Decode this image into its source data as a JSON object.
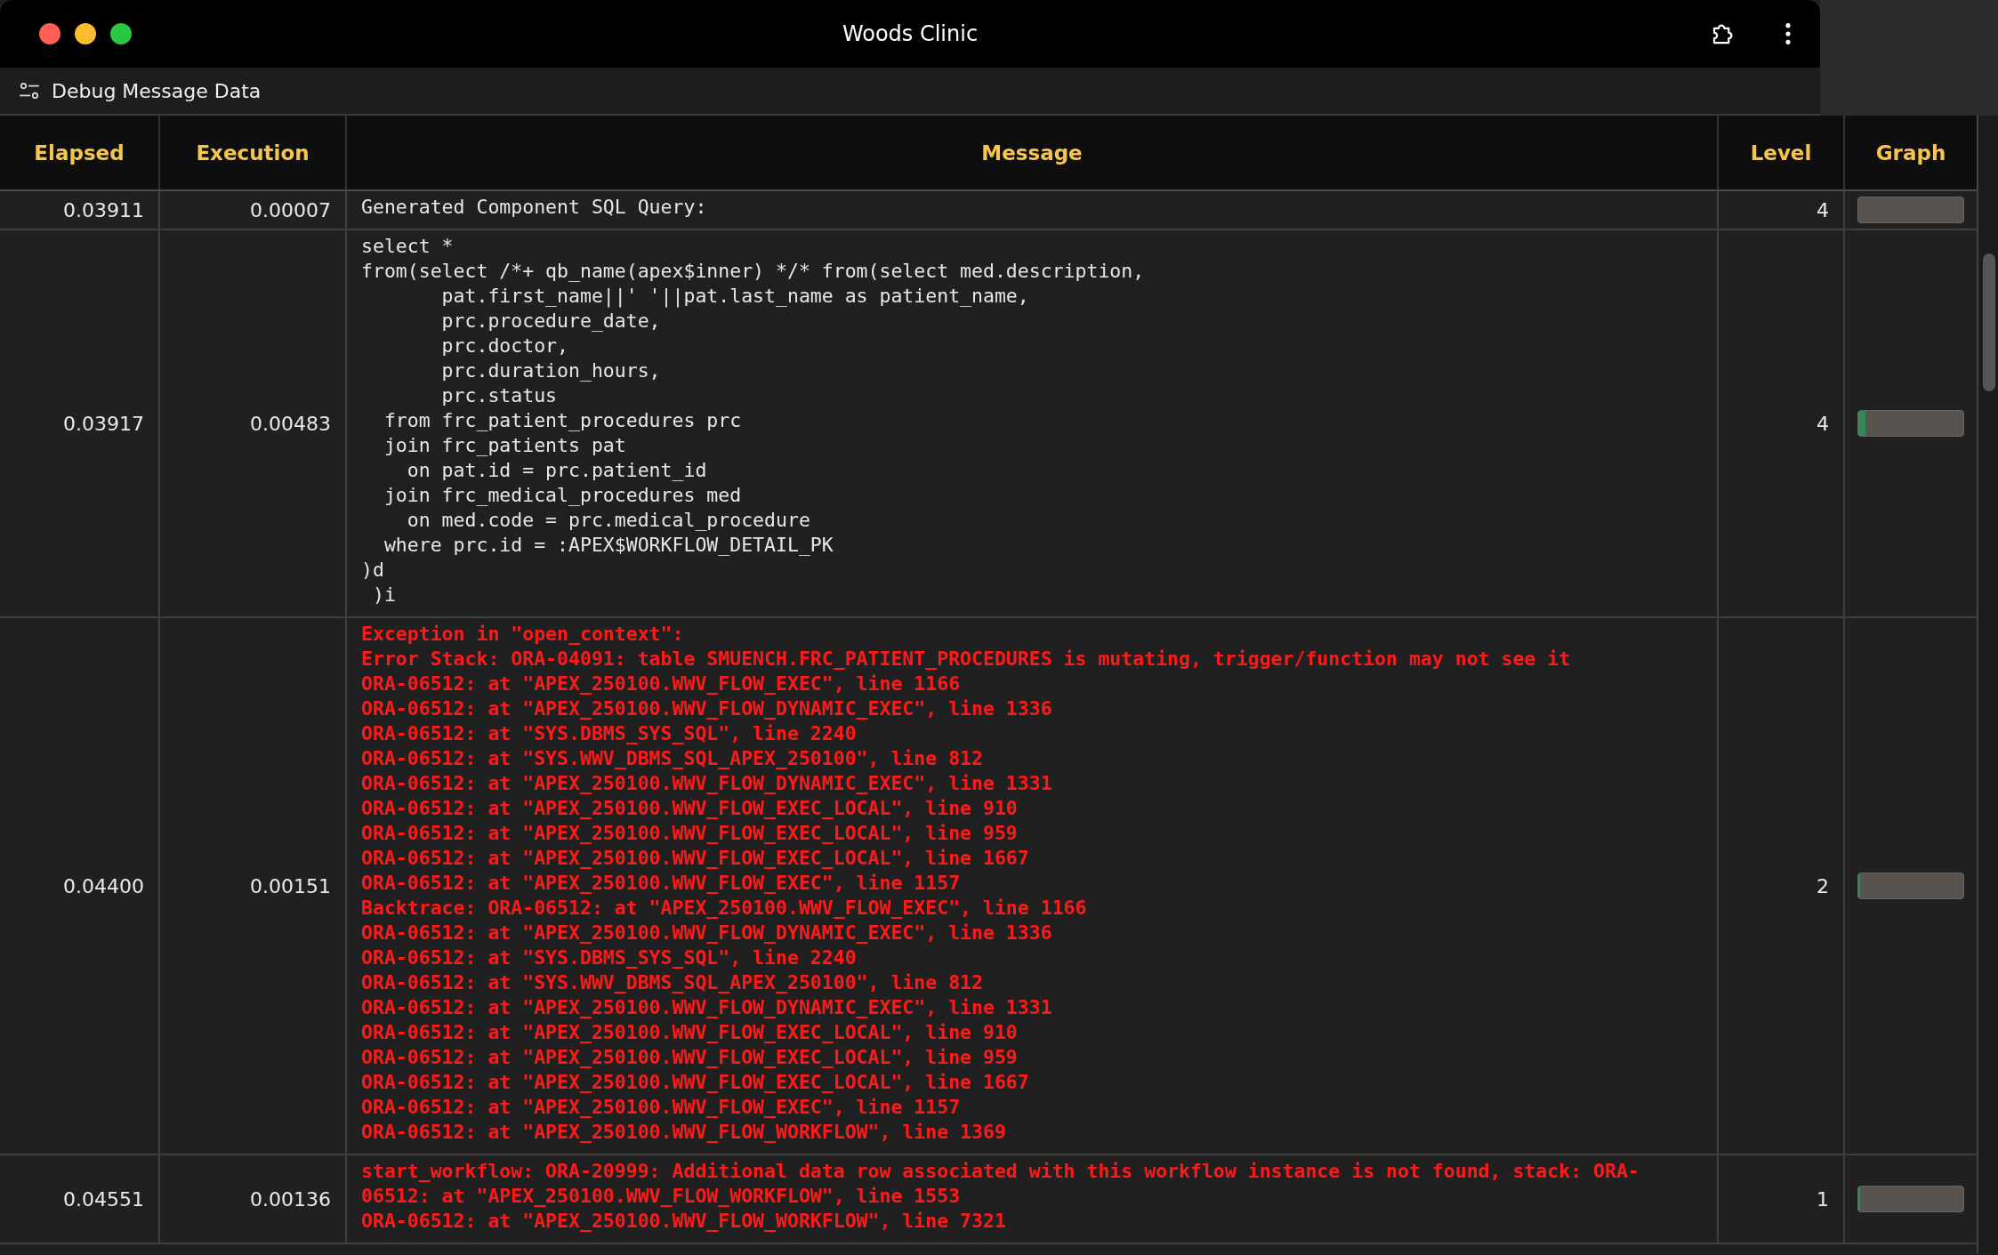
{
  "window": {
    "title": "Woods Clinic"
  },
  "toolbar": {
    "title": "Debug Message Data"
  },
  "table": {
    "columns": [
      "Elapsed",
      "Execution",
      "Message",
      "Level",
      "Graph"
    ],
    "rows": [
      {
        "elapsed": "0.03911",
        "execution": "0.00007",
        "kind": "normal",
        "message": "Generated Component SQL Query:",
        "log_level": "4"
      },
      {
        "elapsed": "0.03917",
        "execution": "0.00483",
        "kind": "normal",
        "message": "select *\nfrom(select /*+ qb_name(apex$inner) */* from(select med.description,\n       pat.first_name||' '||pat.last_name as patient_name,\n       prc.procedure_date,\n       prc.doctor,\n       prc.duration_hours,\n       prc.status\n  from frc_patient_procedures prc\n  join frc_patients pat\n    on pat.id = prc.patient_id\n  join frc_medical_procedures med\n    on med.code = prc.medical_procedure\n  where prc.id = :APEX$WORKFLOW_DETAIL_PK\n)d\n )i",
        "log_level": "4",
        "graph": {
          "level": 0.07
        }
      },
      {
        "elapsed": "0.04400",
        "execution": "0.00151",
        "kind": "error",
        "message": "Exception in \"open_context\":\nError Stack: ORA-04091: table SMUENCH.FRC_PATIENT_PROCEDURES is mutating, trigger/function may not see it\nORA-06512: at \"APEX_250100.WWV_FLOW_EXEC\", line 1166\nORA-06512: at \"APEX_250100.WWV_FLOW_DYNAMIC_EXEC\", line 1336\nORA-06512: at \"SYS.DBMS_SYS_SQL\", line 2240\nORA-06512: at \"SYS.WWV_DBMS_SQL_APEX_250100\", line 812\nORA-06512: at \"APEX_250100.WWV_FLOW_DYNAMIC_EXEC\", line 1331\nORA-06512: at \"APEX_250100.WWV_FLOW_EXEC_LOCAL\", line 910\nORA-06512: at \"APEX_250100.WWV_FLOW_EXEC_LOCAL\", line 959\nORA-06512: at \"APEX_250100.WWV_FLOW_EXEC_LOCAL\", line 1667\nORA-06512: at \"APEX_250100.WWV_FLOW_EXEC\", line 1157\nBacktrace: ORA-06512: at \"APEX_250100.WWV_FLOW_EXEC\", line 1166\nORA-06512: at \"APEX_250100.WWV_FLOW_DYNAMIC_EXEC\", line 1336\nORA-06512: at \"SYS.DBMS_SYS_SQL\", line 2240\nORA-06512: at \"SYS.WWV_DBMS_SQL_APEX_250100\", line 812\nORA-06512: at \"APEX_250100.WWV_FLOW_DYNAMIC_EXEC\", line 1331\nORA-06512: at \"APEX_250100.WWV_FLOW_EXEC_LOCAL\", line 910\nORA-06512: at \"APEX_250100.WWV_FLOW_EXEC_LOCAL\", line 959\nORA-06512: at \"APEX_250100.WWV_FLOW_EXEC_LOCAL\", line 1667\nORA-06512: at \"APEX_250100.WWV_FLOW_EXEC\", line 1157\nORA-06512: at \"APEX_250100.WWV_FLOW_WORKFLOW\", line 1369",
        "log_level": "2",
        "graph": {
          "level": 0.02
        }
      },
      {
        "elapsed": "0.04551",
        "execution": "0.00136",
        "kind": "error",
        "message": "start_workflow: ORA-20999: Additional data row associated with this workflow instance is not found, stack: ORA-\n06512: at \"APEX_250100.WWV_FLOW_WORKFLOW\", line 1553\nORA-06512: at \"APEX_250100.WWV_FLOW_WORKFLOW\", line 7321",
        "log_level": "1",
        "graph": {
          "level": 0.015
        }
      }
    ]
  }
}
